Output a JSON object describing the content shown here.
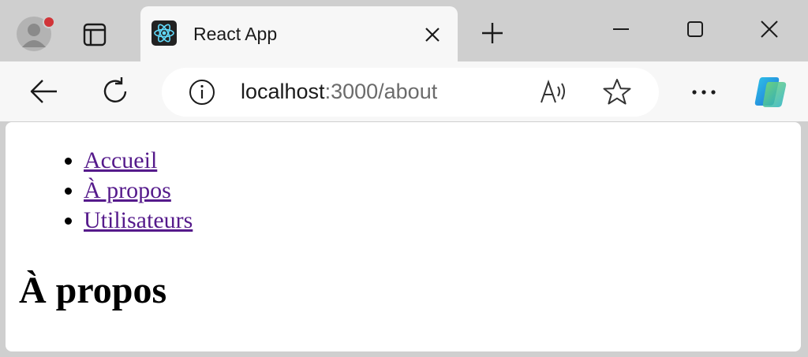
{
  "browser": {
    "tab": {
      "title": "React App"
    },
    "address": {
      "host": "localhost",
      "rest": ":3000/about"
    }
  },
  "page": {
    "nav": [
      "Accueil",
      "À propos",
      "Utilisateurs"
    ],
    "heading": "À propos"
  },
  "colors": {
    "visited_link": "#551a8b",
    "notification_dot": "#d13438",
    "react_logo": "#61dafb"
  }
}
